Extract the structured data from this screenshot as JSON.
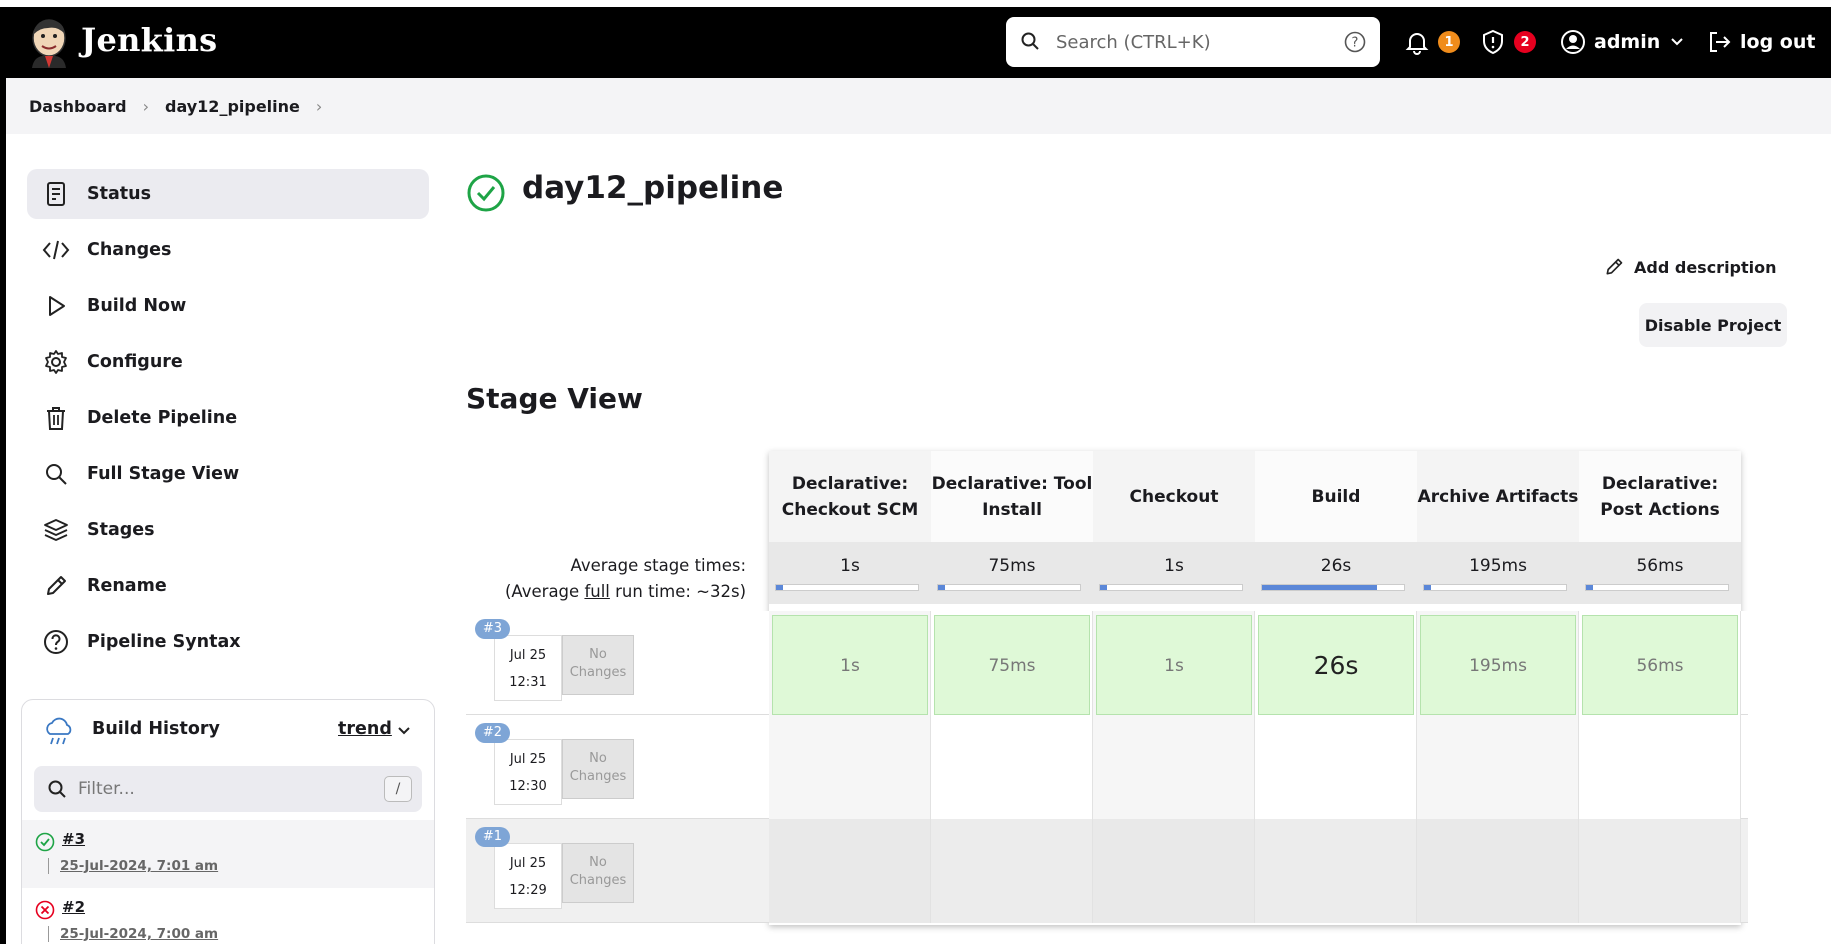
{
  "header": {
    "brand": "Jenkins",
    "search_placeholder": "Search (CTRL+K)",
    "notifications_count": "1",
    "security_count": "2",
    "user": "admin",
    "logout": "log out",
    "colors": {
      "bg": "#000000",
      "notif_badge": "#f08c1b",
      "security_badge": "#e6001f"
    }
  },
  "breadcrumb": [
    "Dashboard",
    "day12_pipeline"
  ],
  "sidebar": {
    "items": [
      {
        "label": "Status",
        "icon": "document-icon"
      },
      {
        "label": "Changes",
        "icon": "code-icon"
      },
      {
        "label": "Build Now",
        "icon": "play-icon"
      },
      {
        "label": "Configure",
        "icon": "gear-icon"
      },
      {
        "label": "Delete Pipeline",
        "icon": "trash-icon"
      },
      {
        "label": "Full Stage View",
        "icon": "search-icon"
      },
      {
        "label": "Stages",
        "icon": "layers-icon"
      },
      {
        "label": "Rename",
        "icon": "pencil-icon"
      },
      {
        "label": "Pipeline Syntax",
        "icon": "help-icon"
      }
    ]
  },
  "build_history": {
    "title": "Build History",
    "trend": "trend",
    "filter_placeholder": "Filter...",
    "filter_shortcut": "/",
    "builds": [
      {
        "number": "#3",
        "date": "25-Jul-2024, 7:01 am",
        "status": "success"
      },
      {
        "number": "#2",
        "date": "25-Jul-2024, 7:00 am",
        "status": "failed"
      }
    ]
  },
  "main": {
    "title": "day12_pipeline",
    "add_description": "Add description",
    "disable_project": "Disable Project",
    "stage_view_title": "Stage View",
    "avg_label_line1": "Average stage times:",
    "avg_label_line2_pre": "(Average ",
    "avg_label_line2_link": "full",
    "avg_label_line2_post": " run time: ~32s)",
    "stages": [
      {
        "name": "Declarative: Checkout SCM",
        "avg": "1s",
        "avg_fraction": 0.05
      },
      {
        "name": "Declarative: Tool Install",
        "avg": "75ms",
        "avg_fraction": 0.02
      },
      {
        "name": "Checkout",
        "avg": "1s",
        "avg_fraction": 0.05
      },
      {
        "name": "Build",
        "avg": "26s",
        "avg_fraction": 0.81
      },
      {
        "name": "Archive Artifacts",
        "avg": "195ms",
        "avg_fraction": 0.02
      },
      {
        "name": "Declarative: Post Actions",
        "avg": "56ms",
        "avg_fraction": 0.02
      }
    ],
    "runs": [
      {
        "tag": "#3",
        "date": "Jul 25",
        "time": "12:31",
        "changes": "No Changes",
        "durations": [
          "1s",
          "75ms",
          "1s",
          "26s",
          "195ms",
          "56ms"
        ]
      },
      {
        "tag": "#2",
        "date": "Jul 25",
        "time": "12:30",
        "changes": "No Changes",
        "durations": []
      },
      {
        "tag": "#1",
        "date": "Jul 25",
        "time": "12:29",
        "changes": "No Changes",
        "durations": []
      }
    ]
  }
}
